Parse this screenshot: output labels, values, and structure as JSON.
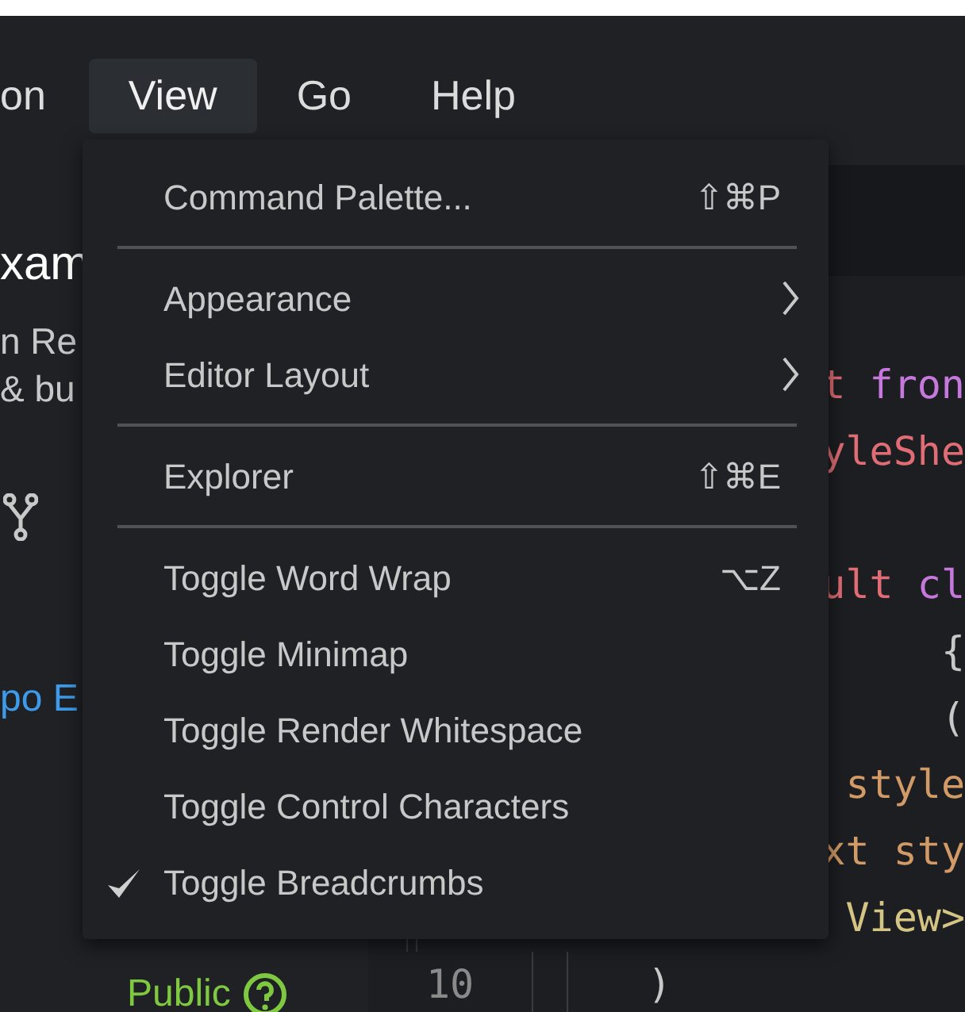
{
  "menubar": [
    {
      "label": "on",
      "selected": false
    },
    {
      "label": "View",
      "selected": true
    },
    {
      "label": "Go",
      "selected": false
    },
    {
      "label": "Help",
      "selected": false
    }
  ],
  "sidebar": {
    "title": "xam",
    "description": [
      "n Re",
      "& bu"
    ],
    "link": "po E",
    "visibility": "Public"
  },
  "editor": {
    "lines": [
      {
        "tokens": [
          {
            "text": "t ",
            "kind": "keyword"
          },
          {
            "text": "fron",
            "kind": "purple"
          }
        ]
      },
      {
        "tokens": [
          {
            "text": "yleShe",
            "kind": "keyword"
          }
        ]
      },
      {
        "tokens": [
          {
            "text": "ult ",
            "kind": "keyword"
          },
          {
            "text": "cl",
            "kind": "purple"
          }
        ]
      },
      {
        "tokens": [
          {
            "text": "{",
            "kind": "plain"
          }
        ]
      },
      {
        "tokens": [
          {
            "text": "(",
            "kind": "plain"
          }
        ]
      },
      {
        "tokens": [
          {
            "text": " style",
            "kind": "attr"
          }
        ]
      },
      {
        "tokens": [
          {
            "text": "xt sty",
            "kind": "attr"
          }
        ]
      },
      {
        "tokens": [
          {
            "text": "View>",
            "kind": "tag"
          }
        ]
      },
      {
        "number": "10",
        "tokens": [
          {
            "text": ")",
            "kind": "plain"
          }
        ]
      }
    ]
  },
  "view_menu": {
    "items": [
      {
        "kind": "item",
        "label": "Command Palette...",
        "shortcut": "⇧⌘P",
        "checked": false
      },
      {
        "kind": "separator"
      },
      {
        "kind": "submenu",
        "label": "Appearance",
        "checked": false
      },
      {
        "kind": "submenu",
        "label": "Editor Layout",
        "checked": false
      },
      {
        "kind": "separator"
      },
      {
        "kind": "item",
        "label": "Explorer",
        "shortcut": "⇧⌘E",
        "checked": false
      },
      {
        "kind": "separator"
      },
      {
        "kind": "item",
        "label": "Toggle Word Wrap",
        "shortcut": "⌥Z",
        "checked": false
      },
      {
        "kind": "item",
        "label": "Toggle Minimap",
        "checked": false
      },
      {
        "kind": "item",
        "label": "Toggle Render Whitespace",
        "checked": false
      },
      {
        "kind": "item",
        "label": "Toggle Control Characters",
        "checked": false
      },
      {
        "kind": "item",
        "label": "Toggle Breadcrumbs",
        "checked": true
      }
    ]
  }
}
